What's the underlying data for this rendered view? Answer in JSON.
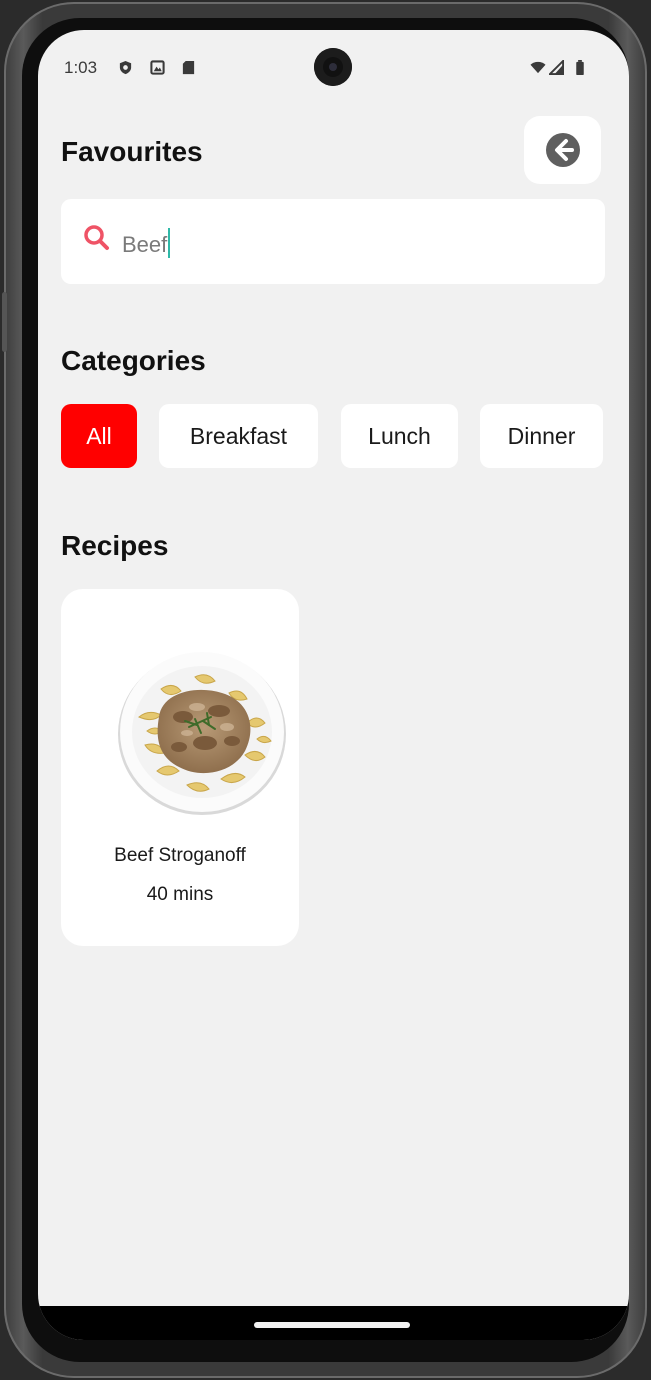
{
  "status_bar": {
    "time": "1:03",
    "left_icons": [
      "shield-icon",
      "image-icon",
      "sd-card-icon"
    ],
    "right_icons": [
      "wifi-icon",
      "signal-icon",
      "battery-icon"
    ]
  },
  "header": {
    "title": "Favourites",
    "back_icon": "arrow-left-circle-icon"
  },
  "search": {
    "icon": "search-icon",
    "value": "Beef",
    "icon_color": "#ef5366",
    "caret_color": "#2fb9a8"
  },
  "categories": {
    "title": "Categories",
    "items": [
      {
        "label": "All",
        "active": true
      },
      {
        "label": "Breakfast",
        "active": false
      },
      {
        "label": "Lunch",
        "active": false
      },
      {
        "label": "Dinner",
        "active": false
      }
    ],
    "active_color": "#ff0000"
  },
  "recipes": {
    "title": "Recipes",
    "items": [
      {
        "name": "Beef Stroganoff",
        "time": "40 mins",
        "image": "beef-stroganoff-photo"
      }
    ]
  }
}
